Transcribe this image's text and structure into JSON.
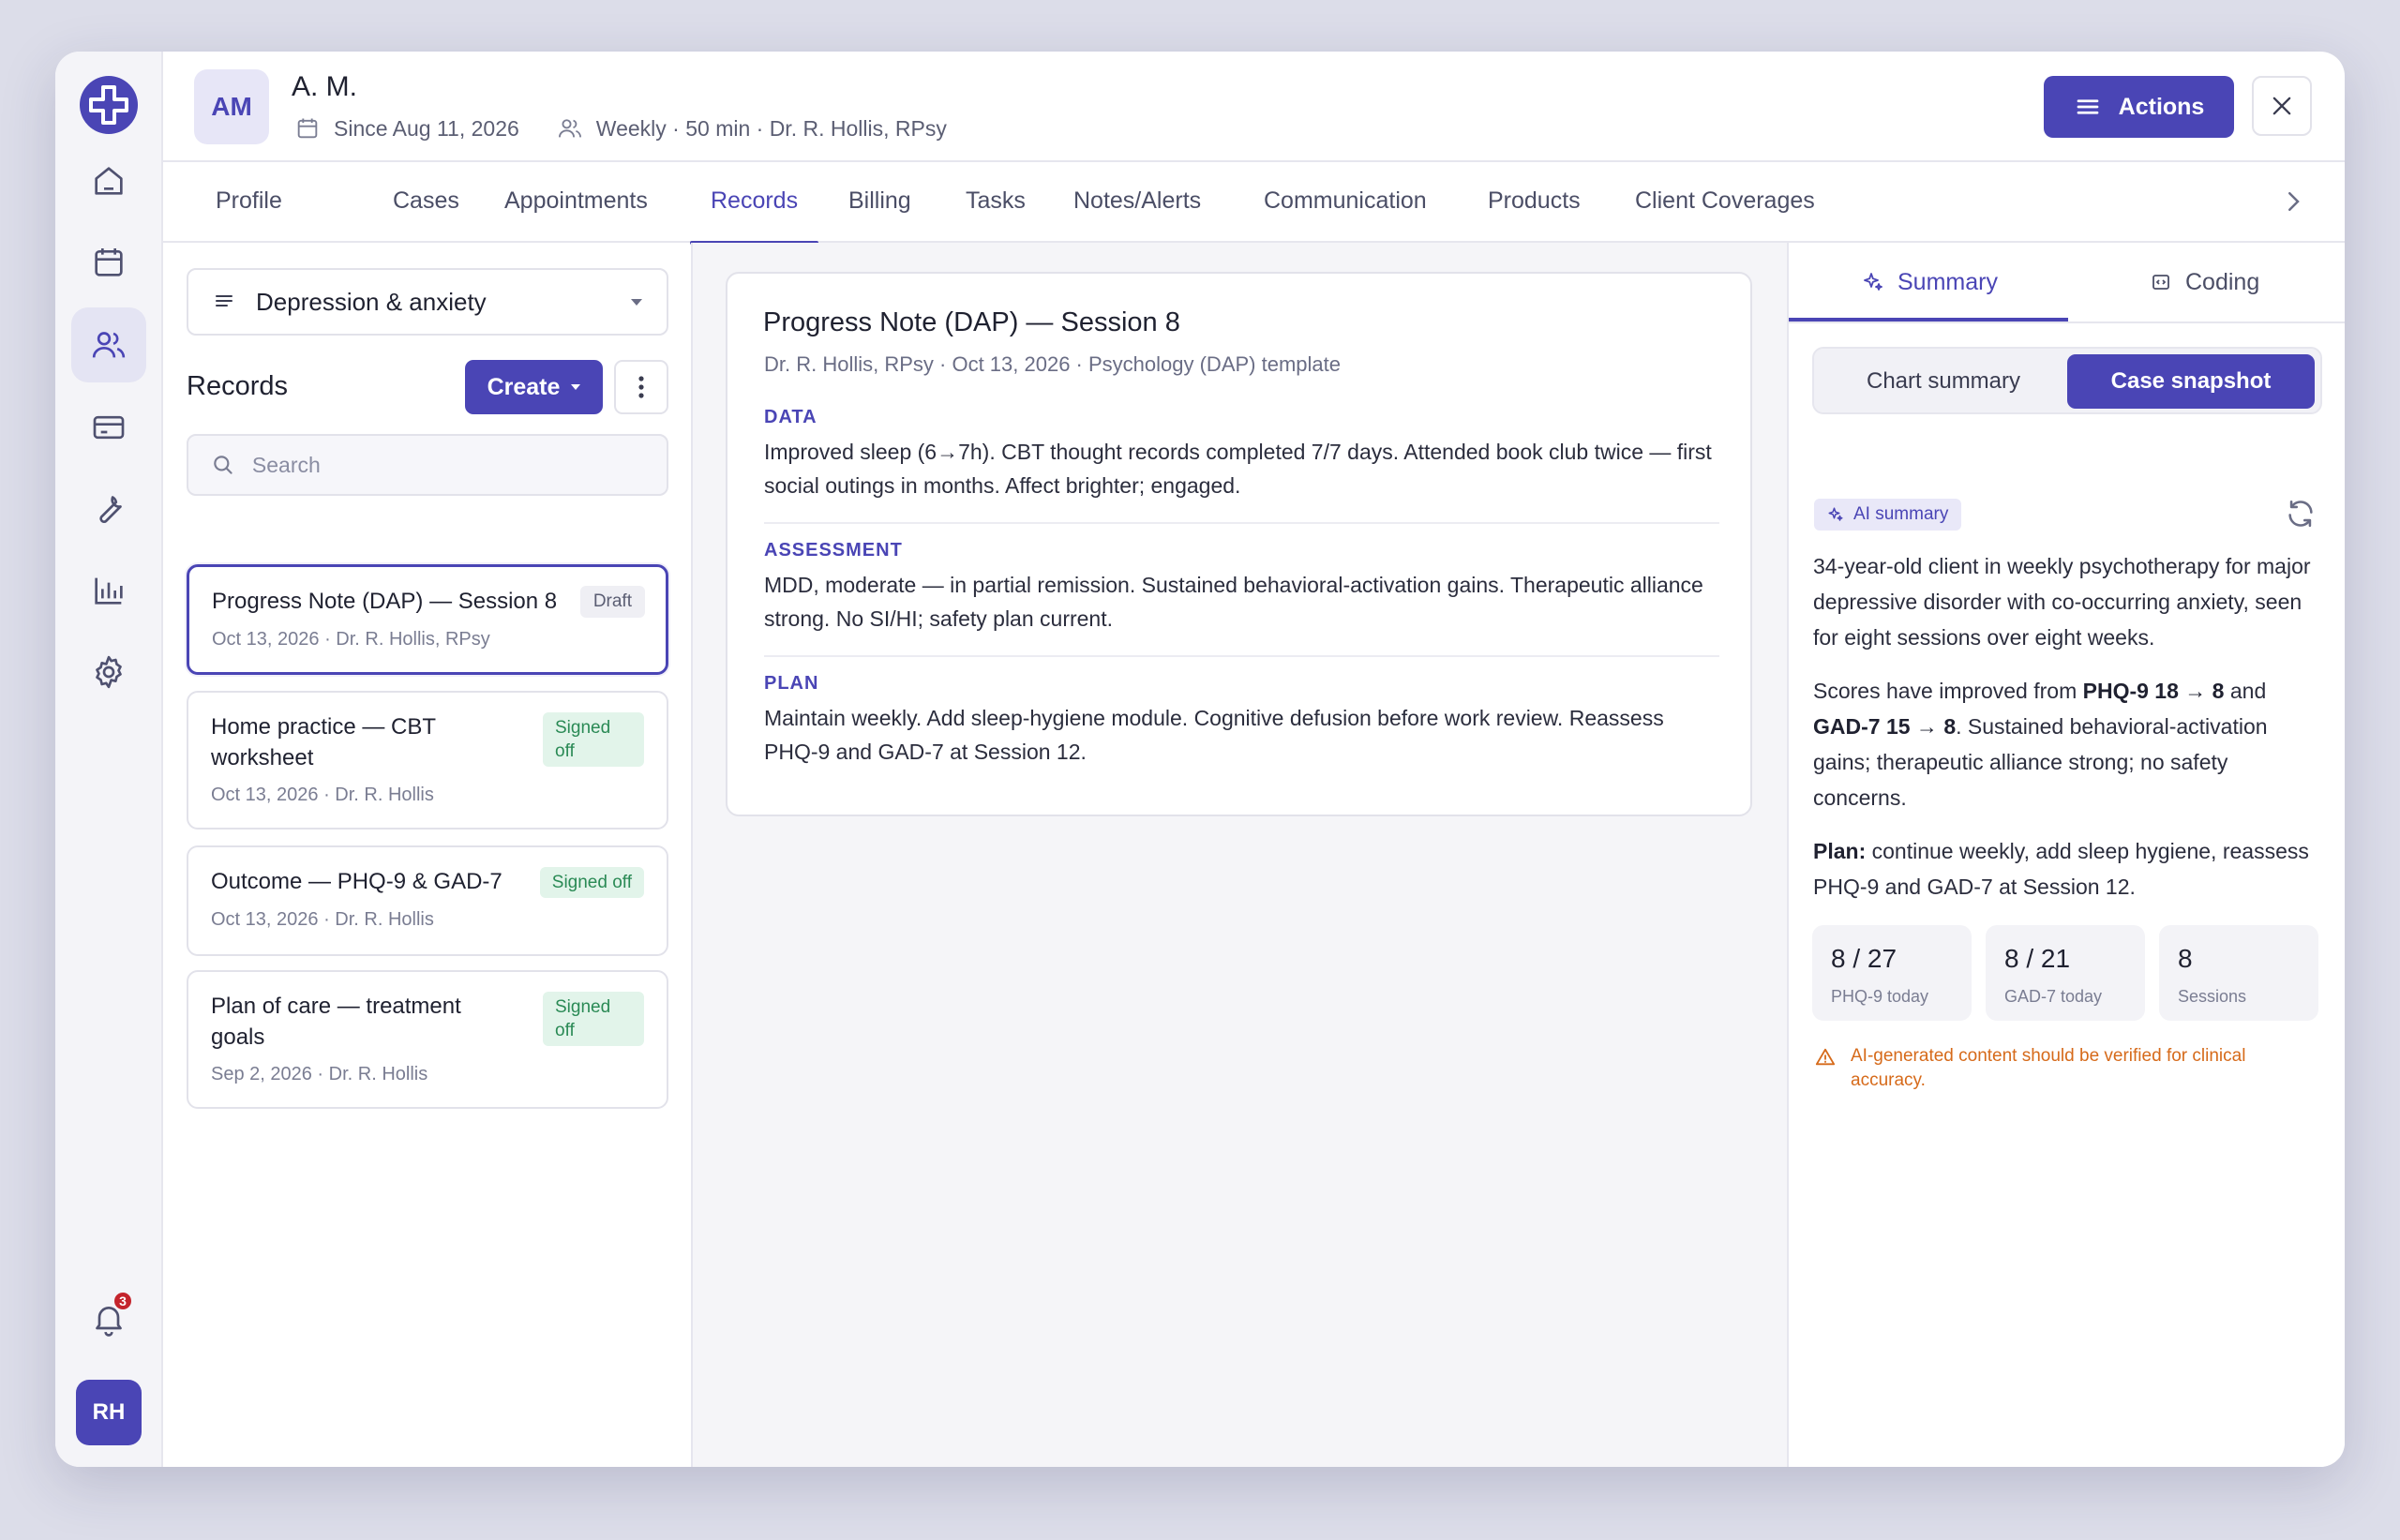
{
  "client": {
    "initials": "AM",
    "name": "A. M.",
    "since": "Since Aug 11, 2026",
    "schedule": "Weekly · 50 min · Dr. R. Hollis, RPsy"
  },
  "header": {
    "actions_label": "Actions"
  },
  "tabs": [
    {
      "label": "Profile"
    },
    {
      "label": "Cases"
    },
    {
      "label": "Appointments"
    },
    {
      "label": "Records"
    },
    {
      "label": "Billing"
    },
    {
      "label": "Tasks"
    },
    {
      "label": "Notes/Alerts"
    },
    {
      "label": "Communication"
    },
    {
      "label": "Products"
    },
    {
      "label": "Client Coverages"
    }
  ],
  "active_tab": "Records",
  "rail": {
    "items": [
      "home-icon",
      "calendar-icon",
      "users-icon",
      "card-icon",
      "wrench-icon",
      "chart-icon",
      "gear-icon"
    ],
    "notification_count": "3",
    "user_initials": "RH"
  },
  "records": {
    "case_filter": "Depression & anxiety",
    "title": "Records",
    "create_label": "Create",
    "search_placeholder": "Search",
    "items": [
      {
        "title": "Progress Note (DAP) — Session 8",
        "meta": "Oct 13, 2026 · Dr. R. Hollis, RPsy",
        "status": "Draft"
      },
      {
        "title": "Home practice — CBT worksheet",
        "meta": "Oct 13, 2026 · Dr. R. Hollis",
        "status": "Signed off"
      },
      {
        "title": "Outcome — PHQ-9 & GAD-7",
        "meta": "Oct 13, 2026 · Dr. R. Hollis",
        "status": "Signed off"
      },
      {
        "title": "Plan of care — treatment goals",
        "meta": "Sep 2, 2026 · Dr. R. Hollis",
        "status": "Signed off"
      }
    ]
  },
  "document": {
    "title": "Progress Note (DAP) — Session 8",
    "subtitle": "Dr. R. Hollis, RPsy · Oct 13, 2026 · Psychology (DAP) template",
    "sections": [
      {
        "label": "DATA",
        "body": "Improved sleep (6→7h). CBT thought records completed 7/7 days. Attended book club twice — first social outings in months. Affect brighter; engaged."
      },
      {
        "label": "ASSESSMENT",
        "body": "MDD, moderate — in partial remission. Sustained behavioral-activation gains. Therapeutic alliance strong. No SI/HI; safety plan current."
      },
      {
        "label": "PLAN",
        "body": "Maintain weekly. Add sleep-hygiene module. Cognitive defusion before work review. Reassess PHQ-9 and GAD-7 at Session 12."
      }
    ]
  },
  "side": {
    "tabs": [
      {
        "label": "Summary"
      },
      {
        "label": "Coding"
      }
    ],
    "segments": [
      {
        "label": "Chart summary"
      },
      {
        "label": "Case snapshot"
      }
    ],
    "ai_chip": "AI summary",
    "p1": "34-year-old client in weekly psychotherapy for major depressive disorder with co-occurring anxiety, seen for eight sessions over eight weeks.",
    "p2_a": "Scores have improved from ",
    "p2_b": "PHQ-9 18 → 8",
    "p2_c": " and ",
    "p2_d": "GAD-7 15 → 8",
    "p2_e": ". Sustained behavioral-activation gains; therapeutic alliance strong; no safety concerns.",
    "p3_label": "Plan:",
    "p3_text": " continue weekly, add sleep hygiene, reassess PHQ-9 and GAD-7 at Session 12.",
    "stats": [
      {
        "value": "8 / 27",
        "label": "PHQ-9 today"
      },
      {
        "value": "8 / 21",
        "label": "GAD-7 today"
      },
      {
        "value": "8",
        "label": "Sessions"
      }
    ],
    "warning": "AI-generated content should be verified for clinical accuracy."
  },
  "colors": {
    "accent": "#4a45b5",
    "signed": "#2a8a55",
    "warning": "#d66a1a",
    "badge": "#c4242c"
  }
}
